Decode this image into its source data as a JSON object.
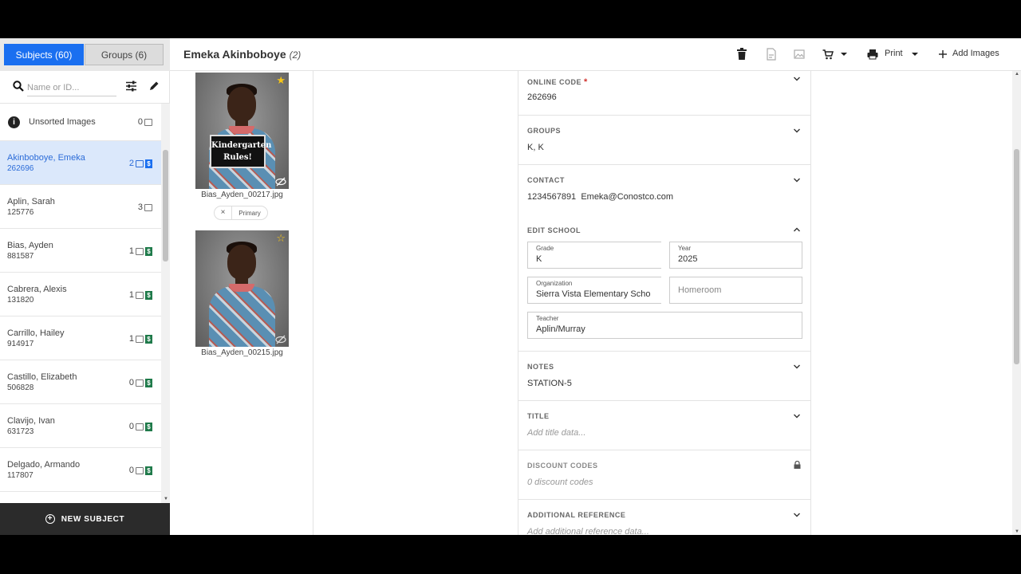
{
  "tabs": {
    "subjects": "Subjects (60)",
    "groups": "Groups (6)"
  },
  "search": {
    "placeholder": "Name or ID..."
  },
  "list": {
    "unsorted": {
      "label": "Unsorted Images",
      "count": "0"
    },
    "items": [
      {
        "name": "Akinboboye, Emeka",
        "id": "262696",
        "count": "2"
      },
      {
        "name": "Aplin, Sarah",
        "id": "125776",
        "count": "3"
      },
      {
        "name": "Bias, Ayden",
        "id": "881587",
        "count": "1"
      },
      {
        "name": "Cabrera, Alexis",
        "id": "131820",
        "count": "1"
      },
      {
        "name": "Carrillo, Hailey",
        "id": "914917",
        "count": "1"
      },
      {
        "name": "Castillo, Elizabeth",
        "id": "506828",
        "count": "0"
      },
      {
        "name": "Clavijo, Ivan",
        "id": "631723",
        "count": "0"
      },
      {
        "name": "Delgado, Armando",
        "id": "117807",
        "count": "0"
      }
    ]
  },
  "new_subject": "NEW SUBJECT",
  "header": {
    "title": "Emeka Akinboboye",
    "count": "(2)",
    "print": "Print",
    "add_images": "Add Images"
  },
  "gallery": {
    "photos": [
      {
        "filename": "Bias_Ayden_00217.jpg",
        "sign_line1": "Kindergarten",
        "sign_line2": "Rules!"
      },
      {
        "filename": "Bias_Ayden_00215.jpg"
      }
    ],
    "primary_label": "Primary",
    "remove_label": "×"
  },
  "details": {
    "online_code": {
      "title": "ONLINE CODE",
      "required": "*",
      "value": "262696"
    },
    "groups": {
      "title": "GROUPS",
      "value": "K,  K"
    },
    "contact": {
      "title": "CONTACT",
      "phone": "1234567891",
      "email": "Emeka@Conostco.com"
    },
    "edit_school": {
      "title": "EDIT SCHOOL",
      "grade_label": "Grade",
      "grade": "K",
      "year_label": "Year",
      "year": "2025",
      "org_label": "Organization",
      "org": "Sierra Vista Elementary Scho",
      "homeroom_placeholder": "Homeroom",
      "teacher_label": "Teacher",
      "teacher": "Aplin/Murray"
    },
    "notes": {
      "title": "NOTES",
      "value": "STATION-5"
    },
    "title_section": {
      "title": "TITLE",
      "placeholder": "Add title data..."
    },
    "discount": {
      "title": "DISCOUNT CODES",
      "value": "0 discount codes"
    },
    "additional": {
      "title": "ADDITIONAL REFERENCE",
      "placeholder": "Add additional reference data..."
    }
  },
  "colors": {
    "accent": "#1a6ff0",
    "badge_green": "#1f7a4a",
    "selected_bg": "#dbe8fb",
    "required": "#d0312d"
  }
}
